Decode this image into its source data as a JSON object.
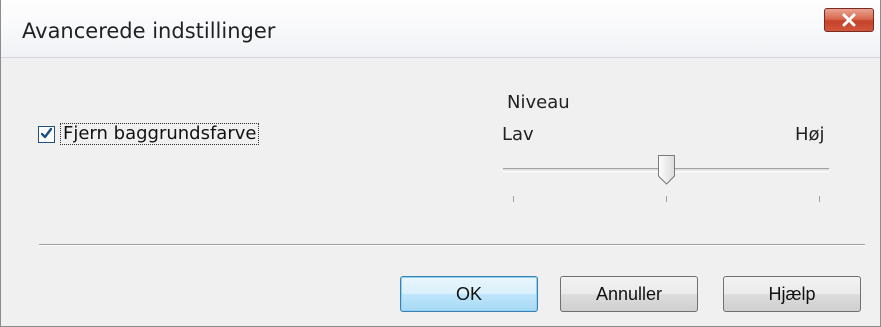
{
  "window": {
    "title": "Avancerede indstillinger"
  },
  "options": {
    "remove_background": {
      "label": "Fjern baggrundsfarve",
      "checked": true
    }
  },
  "level": {
    "heading": "Niveau",
    "low_label": "Lav",
    "high_label": "Høj",
    "value_fraction": 0.5
  },
  "buttons": {
    "ok": "OK",
    "cancel": "Annuller",
    "help": "Hjælp"
  },
  "colors": {
    "close_button": "#c4422a",
    "checkbox_mark": "#1c5180",
    "default_button_border": "#3c7fb1"
  },
  "icons": {
    "close": "close-icon",
    "check": "checkmark-icon"
  }
}
